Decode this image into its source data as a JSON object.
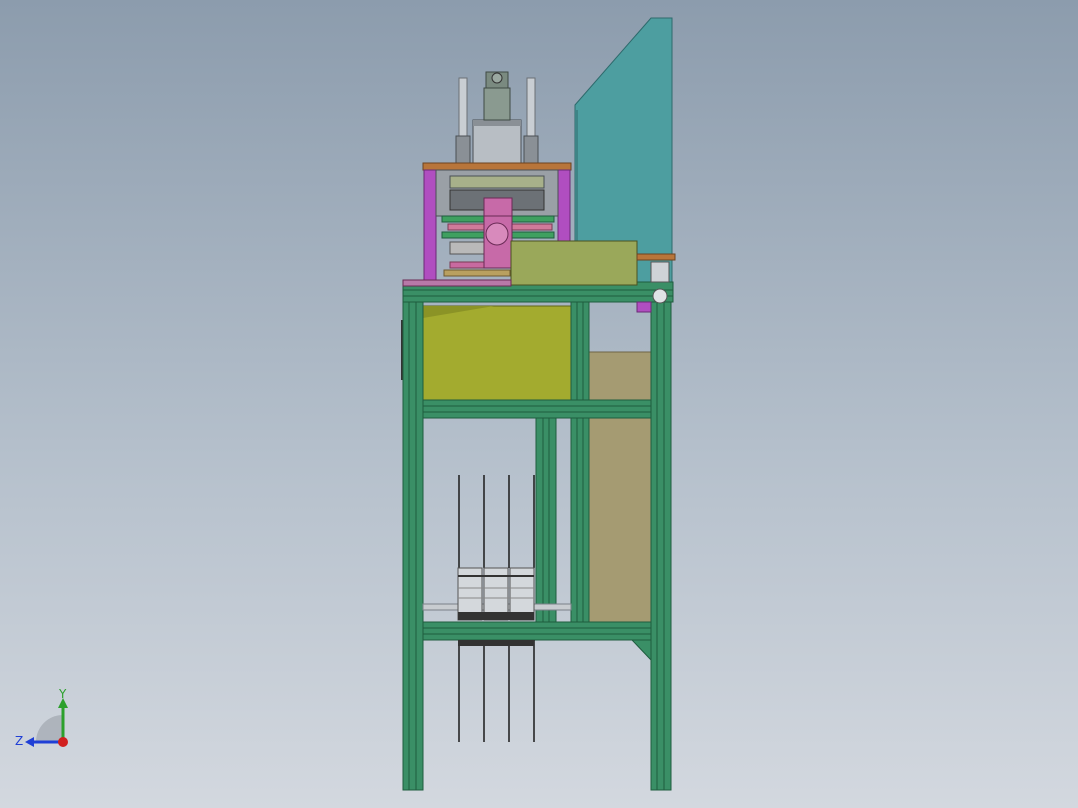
{
  "viewport": {
    "background_top": "#8c9cad",
    "background_bottom": "#d3d8df"
  },
  "colors": {
    "frame_green": "#3a8f66",
    "frame_dark": "#1f5c3e",
    "teal_panel": "#4d9ea0",
    "olive_box": "#a3ab2f",
    "khaki_panel": "#a59b72",
    "magenta_post": "#b04ec0",
    "copper_plate": "#b8753a",
    "gray_metal": "#8a9096",
    "light_metal": "#d4d8dc",
    "sage_box": "#9aa85a"
  },
  "triad": {
    "y_label": "Y",
    "z_label": "Z",
    "y_color": "#2ca02c",
    "z_color": "#1f3fd6",
    "origin_color": "#d11f1f"
  }
}
